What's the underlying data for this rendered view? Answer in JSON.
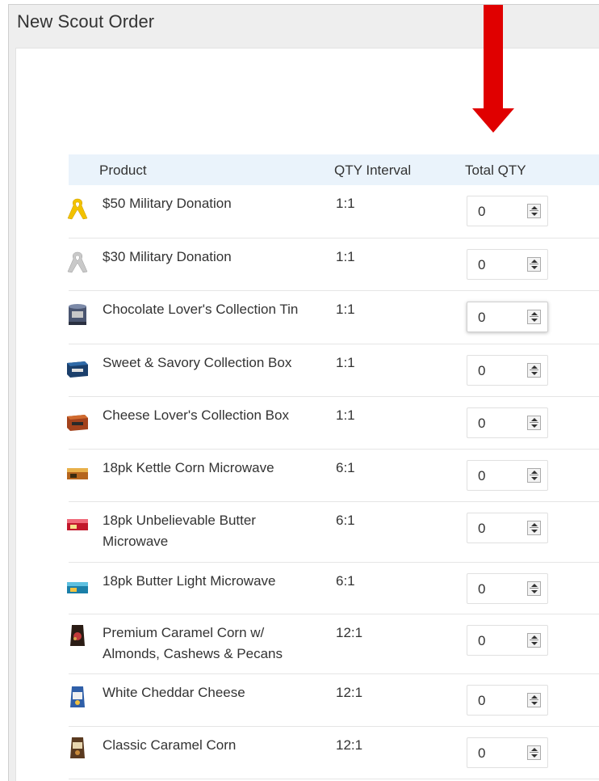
{
  "window": {
    "title": "New Scout Order"
  },
  "table": {
    "headers": {
      "product": "Product",
      "interval": "QTY Interval",
      "total": "Total QTY"
    },
    "rows": [
      {
        "icon": "yellow-ribbon-icon",
        "name": "$50 Military Donation",
        "interval": "1:1",
        "qty": "0"
      },
      {
        "icon": "silver-ribbon-icon",
        "name": "$30 Military Donation",
        "interval": "1:1",
        "qty": "0"
      },
      {
        "icon": "chocolate-tin-icon",
        "name": "Chocolate Lover's Collection Tin",
        "interval": "1:1",
        "qty": "0"
      },
      {
        "icon": "collection-box-icon",
        "name": "Sweet & Savory Collection Box",
        "interval": "1:1",
        "qty": "0"
      },
      {
        "icon": "cheese-box-icon",
        "name": "Cheese Lover's Collection Box",
        "interval": "1:1",
        "qty": "0"
      },
      {
        "icon": "kettle-corn-box-icon",
        "name": "18pk Kettle Corn Microwave",
        "interval": "6:1",
        "qty": "0"
      },
      {
        "icon": "butter-box-icon",
        "name": "18pk Unbelievable Butter Microwave",
        "interval": "6:1",
        "qty": "0"
      },
      {
        "icon": "butter-light-box-icon",
        "name": "18pk Butter Light Microwave",
        "interval": "6:1",
        "qty": "0"
      },
      {
        "icon": "caramel-bag-icon",
        "name": "Premium Caramel Corn w/ Almonds, Cashews & Pecans",
        "interval": "12:1",
        "qty": "0"
      },
      {
        "icon": "cheddar-bag-icon",
        "name": "White Cheddar Cheese",
        "interval": "12:1",
        "qty": "0"
      },
      {
        "icon": "classic-caramel-bag-icon",
        "name": "Classic Caramel Corn",
        "interval": "12:1",
        "qty": "0"
      }
    ]
  },
  "colors": {
    "arrow": "#e00000",
    "header_bg": "#eaf3fb"
  }
}
